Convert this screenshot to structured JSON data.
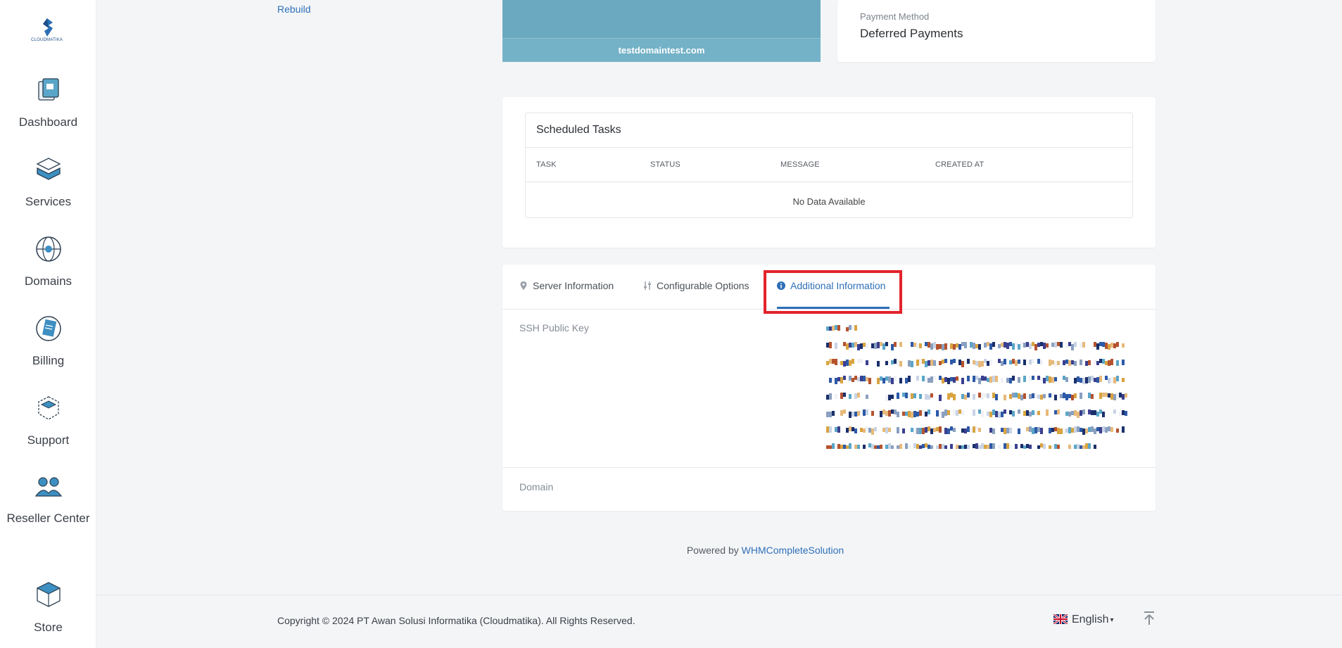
{
  "brand": {
    "logo_text": "CLOUDMATIKA"
  },
  "sidebar": {
    "items": [
      {
        "label": "Dashboard"
      },
      {
        "label": "Services"
      },
      {
        "label": "Domains"
      },
      {
        "label": "Billing"
      },
      {
        "label": "Support"
      },
      {
        "label": "Reseller Center"
      },
      {
        "label": "Store"
      }
    ]
  },
  "main": {
    "rebuild_link": "Rebuild",
    "preview_domain": "testdomaintest.com",
    "payment": {
      "label": "Payment Method",
      "value": "Deferred Payments"
    },
    "scheduled_tasks": {
      "title": "Scheduled Tasks",
      "columns": [
        "TASK",
        "STATUS",
        "MESSAGE",
        "CREATED AT"
      ],
      "empty_text": "No Data Available"
    },
    "tabs": [
      {
        "label": "Server Information",
        "icon": "map-pin-icon"
      },
      {
        "label": "Configurable Options",
        "icon": "sliders-icon"
      },
      {
        "label": "Additional Information",
        "icon": "info-icon",
        "active": true
      }
    ],
    "additional_info": {
      "ssh_label": "SSH Public Key",
      "domain_label": "Domain"
    }
  },
  "powered": {
    "prefix": "Powered by",
    "link": "WHMCompleteSolution"
  },
  "footer": {
    "copyright": "Copyright © 2024 PT Awan Solusi Informatika (Cloudmatika). All Rights Reserved.",
    "language": "English"
  },
  "colors": {
    "accent": "#2e6fb8",
    "highlight": "#e3232b",
    "preview": "#6aa9c0"
  }
}
